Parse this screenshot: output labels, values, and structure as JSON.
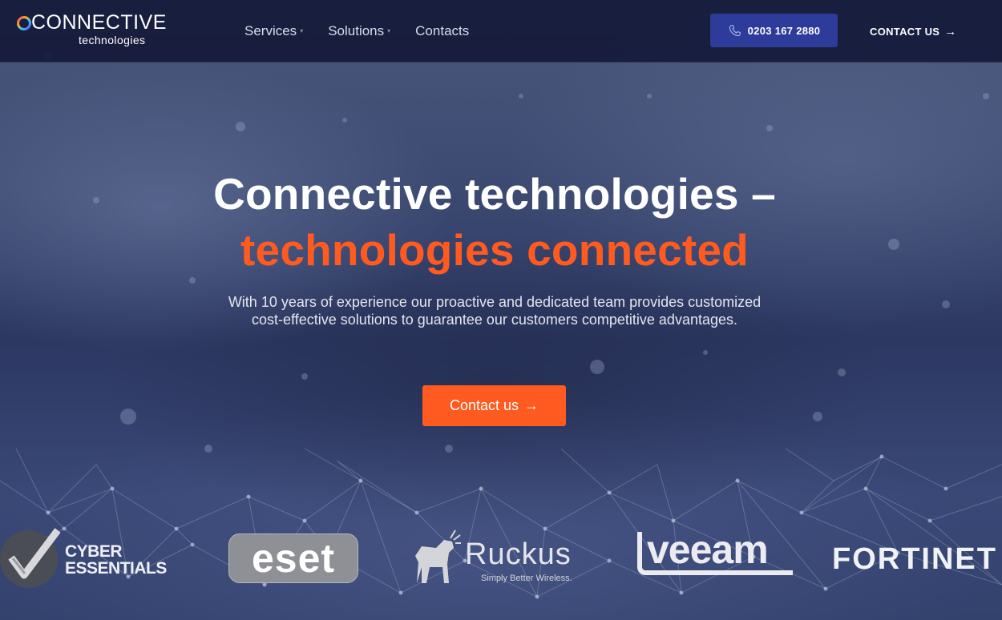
{
  "brand": {
    "name": "CONNECTIVE",
    "tagline": "technologies"
  },
  "nav": {
    "items": [
      {
        "label": "Services",
        "has_dropdown": true
      },
      {
        "label": "Solutions",
        "has_dropdown": true
      },
      {
        "label": "Contacts",
        "has_dropdown": false
      }
    ]
  },
  "header": {
    "phone": "0203 167 2880",
    "contact_label": "CONTACT US",
    "phone_icon": "phone-icon",
    "arrow_icon": "arrow-right-icon"
  },
  "hero": {
    "headline": "Connective technologies –",
    "headline_accent": "technologies connected",
    "description": "With 10 years of experience our proactive and dedicated team provides customized cost-effective solutions to guarantee our customers competitive advantages.",
    "cta_label": "Contact us"
  },
  "partners": {
    "cyber_essentials": {
      "line1": "CYBER",
      "line2": "ESSENTIALS"
    },
    "eset": "eset",
    "ruckus": {
      "name": "Ruckus",
      "tagline": "Simply Better Wireless."
    },
    "veeam": "veeam",
    "fortinet": "FORTINET"
  },
  "colors": {
    "header_bg": "#171c3c",
    "accent": "#ff5a1f",
    "phone_button": "#2d3b9a",
    "text_light": "#ffffff"
  }
}
